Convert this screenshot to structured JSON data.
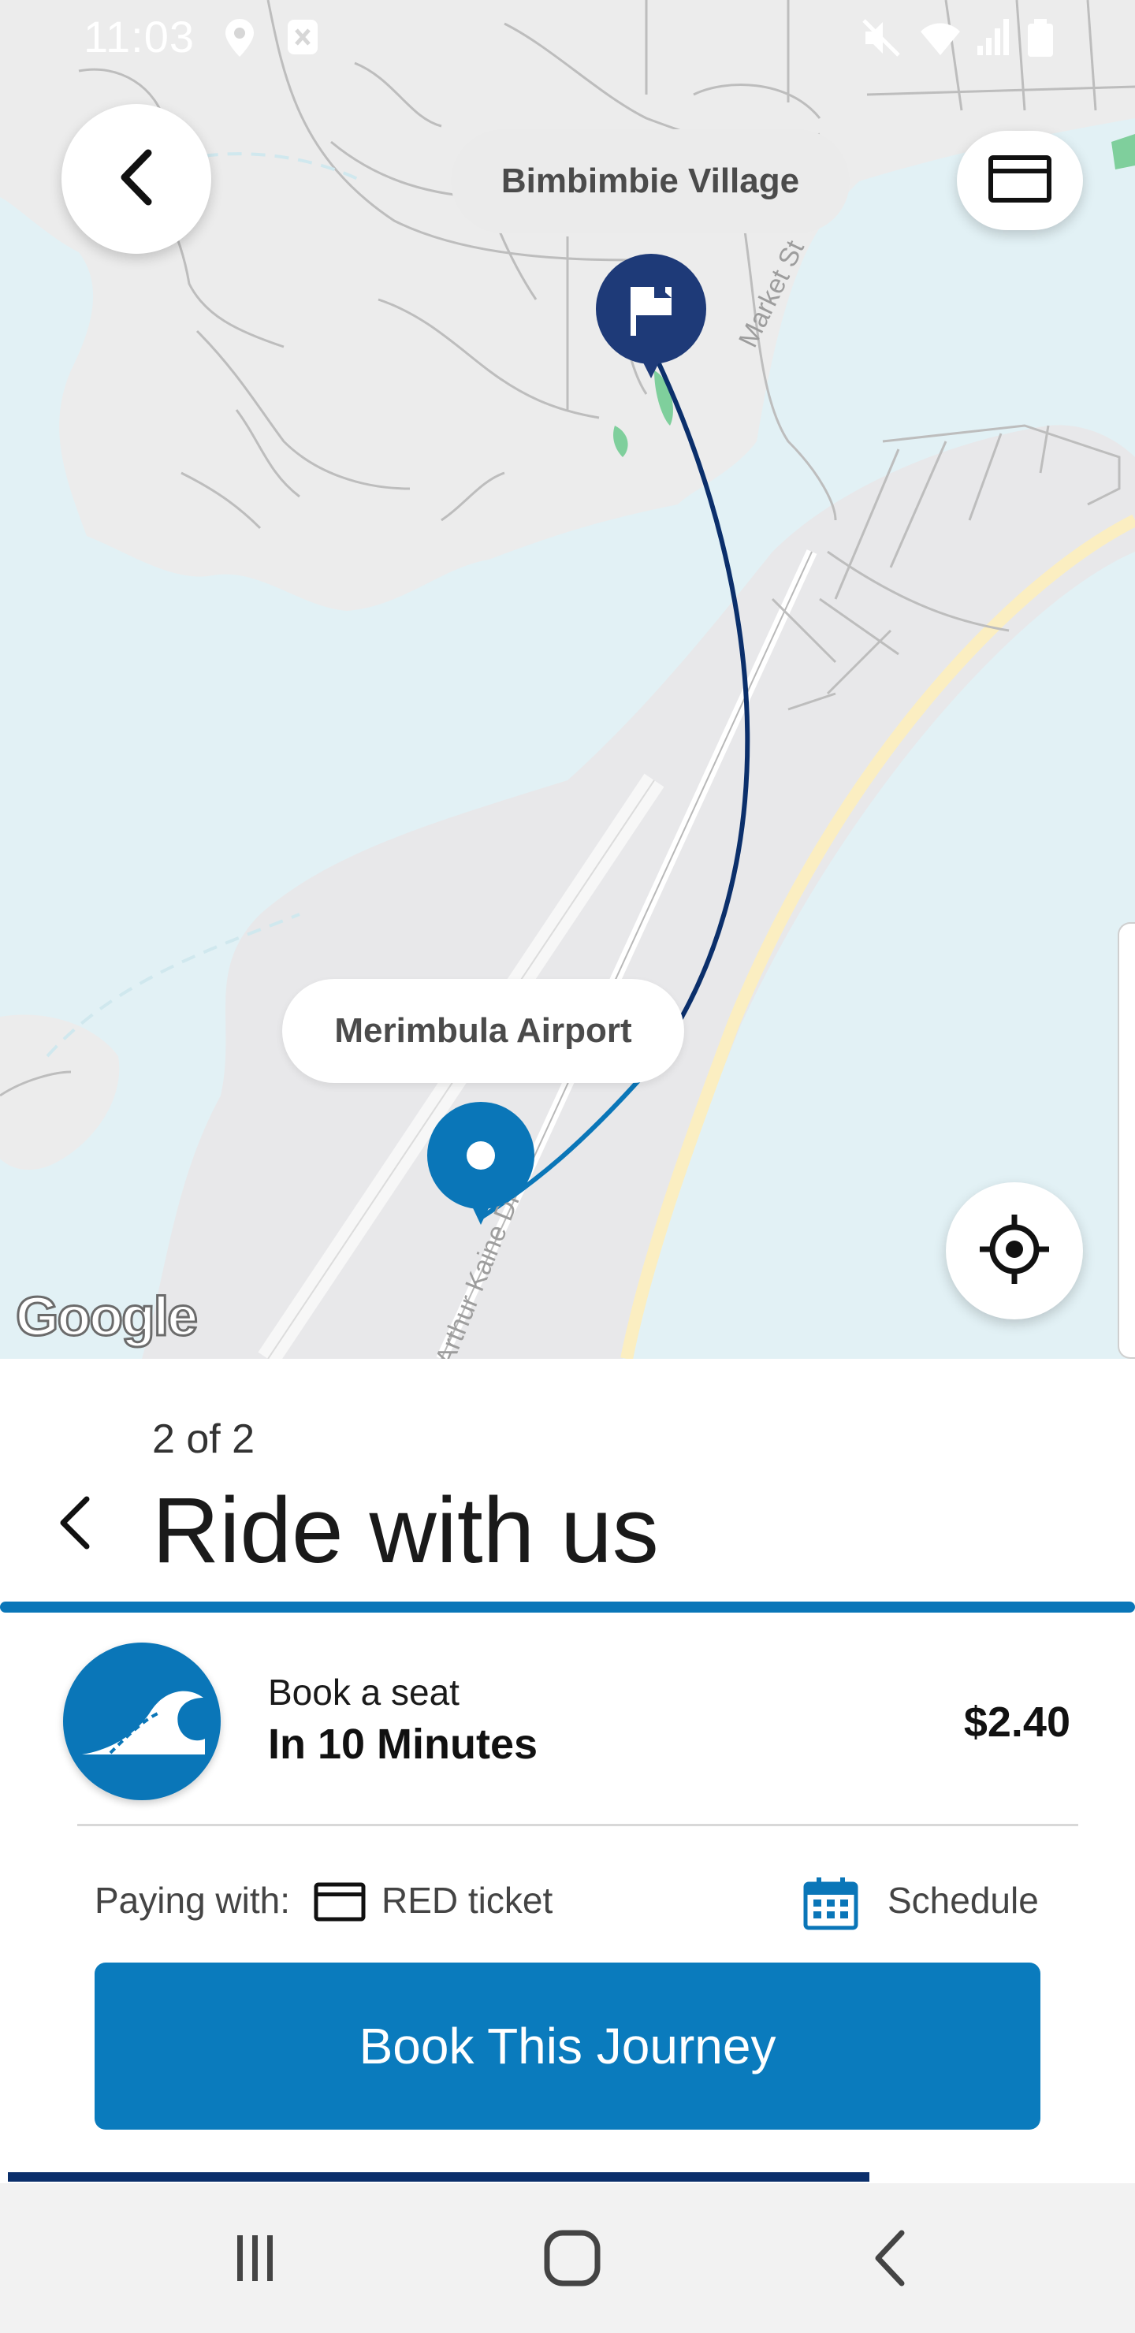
{
  "status_bar": {
    "time": "11:03",
    "icons": [
      "location-icon",
      "blocked-notification-icon",
      "mute-icon",
      "wifi-icon",
      "signal-icon",
      "battery-icon"
    ]
  },
  "map": {
    "origin_label": "Bimbimbie Village",
    "destination_label": "Merimbula Airport",
    "street_labels": [
      "Market St",
      "Arthur Kaine Dr"
    ],
    "attribution": "Google",
    "colors": {
      "water": "#e2f1f5",
      "land": "#eeeeee",
      "route_dark": "#0b2f6b",
      "route_light": "#0a76b8",
      "beach": "#fbeec1"
    }
  },
  "sheet": {
    "step": "2 of 2",
    "title": "Ride with us",
    "service": {
      "label": "Book a seat",
      "eta": "In 10 Minutes",
      "price": "$2.40",
      "icon": "wave-icon"
    },
    "paying_label": "Paying with:",
    "ticket": "RED ticket",
    "schedule_label": "Schedule",
    "book_button": "Book This Journey",
    "progress_fraction": 0.77
  },
  "nav_bar": {
    "icons": [
      "recent-apps-icon",
      "home-icon",
      "back-icon"
    ]
  },
  "colors": {
    "accent": "#0a7bbd",
    "dark_accent": "#0b2f6b"
  }
}
